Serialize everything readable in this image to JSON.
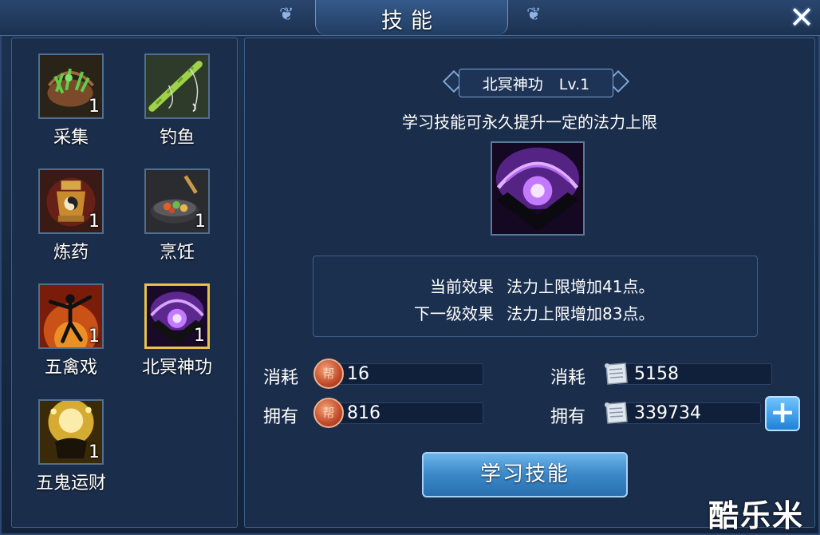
{
  "window": {
    "title": "技能",
    "close_glyph": "✕"
  },
  "skills": [
    {
      "name": "采集",
      "count": "1",
      "icon": "herb-basket-icon",
      "selected": false
    },
    {
      "name": "钓鱼",
      "count": "",
      "icon": "fishing-rod-icon",
      "selected": false
    },
    {
      "name": "炼药",
      "count": "1",
      "icon": "alchemy-furnace-icon",
      "selected": false
    },
    {
      "name": "烹饪",
      "count": "1",
      "icon": "wok-icon",
      "selected": false
    },
    {
      "name": "五禽戏",
      "count": "1",
      "icon": "martial-figure-icon",
      "selected": false
    },
    {
      "name": "北冥神功",
      "count": "1",
      "icon": "purple-orb-icon",
      "selected": true
    },
    {
      "name": "五鬼运财",
      "count": "1",
      "icon": "gold-pot-icon",
      "selected": false
    }
  ],
  "detail": {
    "skill_name": "北冥神功",
    "level": "Lv.1",
    "description": "学习技能可永久提升一定的法力上限",
    "current_effect_label": "当前效果",
    "current_effect_value": "法力上限增加41点。",
    "next_effect_label": "下一级效果",
    "next_effect_value": "法力上限增加83点。"
  },
  "resources": {
    "cost_label": "消耗",
    "own_label": "拥有",
    "coin_glyph": "帮",
    "coin_cost": "16",
    "coin_owned": "816",
    "scroll_cost": "5158",
    "scroll_owned": "339734"
  },
  "actions": {
    "learn_label": "学习技能",
    "add_glyph": "+"
  },
  "watermark": "酷乐米",
  "colors": {
    "selected_border": "#e8c24a",
    "button_blue": "#3a88c8",
    "panel_bg": "#1a2d4a"
  }
}
